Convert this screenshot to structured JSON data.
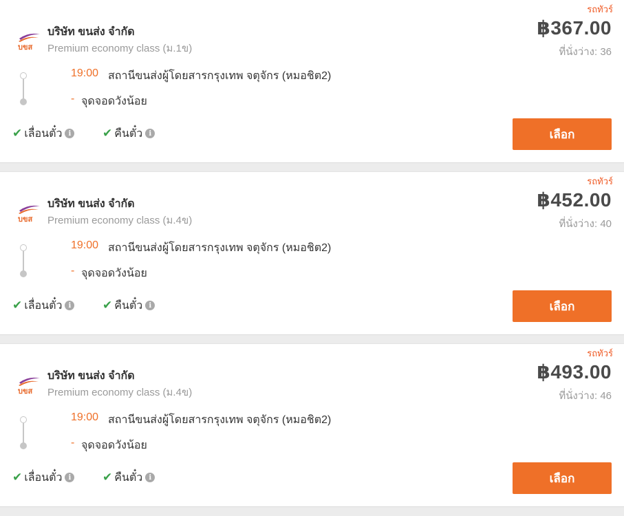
{
  "trips": [
    {
      "company": "บริษัท ขนส่ง จำกัด",
      "bus_class": "Premium economy class (ม.1ข)",
      "bus_type": "รถทัวร์",
      "price": "฿367.00",
      "seats_label": "ที่นั่งว่าง: 36",
      "departure_time": "19:00",
      "departure_station": "สถานีขนส่งผู้โดยสารกรุงเทพ จตุจักร (หมอชิต2)",
      "arrival_dash": "-",
      "arrival_station": "จุดจอดวังน้อย",
      "features": [
        "เลื่อนตั๋ว",
        "คืนตั๋ว"
      ],
      "select_label": "เลือก"
    },
    {
      "company": "บริษัท ขนส่ง จำกัด",
      "bus_class": "Premium economy class (ม.4ข)",
      "bus_type": "รถทัวร์",
      "price": "฿452.00",
      "seats_label": "ที่นั่งว่าง: 40",
      "departure_time": "19:00",
      "departure_station": "สถานีขนส่งผู้โดยสารกรุงเทพ จตุจักร (หมอชิต2)",
      "arrival_dash": "-",
      "arrival_station": "จุดจอดวังน้อย",
      "features": [
        "เลื่อนตั๋ว",
        "คืนตั๋ว"
      ],
      "select_label": "เลือก"
    },
    {
      "company": "บริษัท ขนส่ง จำกัด",
      "bus_class": "Premium economy class (ม.4ข)",
      "bus_type": "รถทัวร์",
      "price": "฿493.00",
      "seats_label": "ที่นั่งว่าง: 46",
      "departure_time": "19:00",
      "departure_station": "สถานีขนส่งผู้โดยสารกรุงเทพ จตุจักร (หมอชิต2)",
      "arrival_dash": "-",
      "arrival_station": "จุดจอดวังน้อย",
      "features": [
        "เลื่อนตั๋ว",
        "คืนตั๋ว"
      ],
      "select_label": "เลือก"
    }
  ],
  "logo_text": "บขส",
  "icons": {
    "check": "check-icon",
    "info": "info-icon",
    "logo": "bks-logo-icon"
  },
  "colors": {
    "accent": "#ef7028",
    "bus_type": "#ef5a24",
    "check": "#3aa14a",
    "price": "#4a4a4a",
    "muted": "#9a9a9a"
  }
}
